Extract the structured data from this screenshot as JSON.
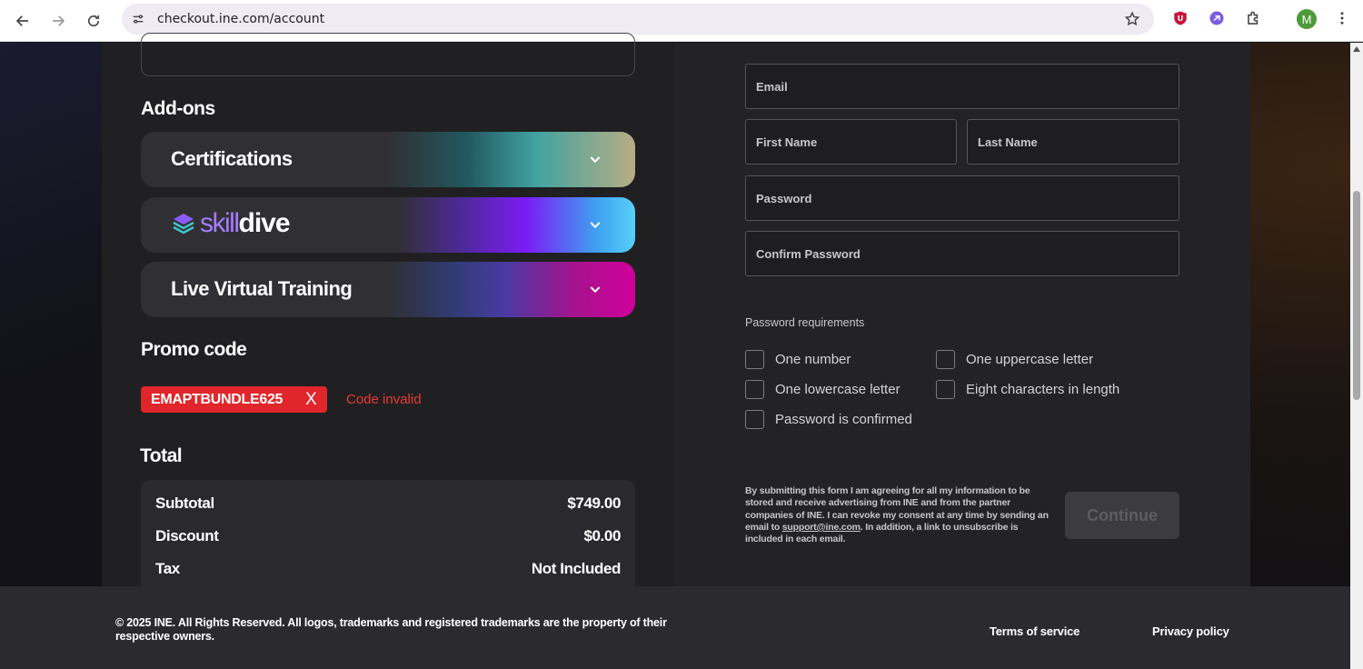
{
  "browser": {
    "url": "checkout.ine.com/account",
    "profile_initial": "M",
    "icons": [
      "back-icon",
      "forward-icon",
      "reload-icon",
      "site-info-icon",
      "bookmark-star-icon",
      "ublock-icon",
      "extension-icon",
      "puzzle-icon",
      "menu-dots-icon"
    ]
  },
  "addons": {
    "heading": "Add-ons",
    "items": [
      {
        "label": "Certifications"
      },
      {
        "label_a": "skill",
        "label_b": "dive"
      },
      {
        "label": "Live Virtual Training"
      }
    ]
  },
  "promo": {
    "heading": "Promo code",
    "code": "EMAPTBUNDLE625",
    "remove": "X",
    "status": "Code invalid",
    "status_color": "#e83a36"
  },
  "total": {
    "heading": "Total",
    "rows": [
      {
        "label": "Subtotal",
        "value": "$749.00"
      },
      {
        "label": "Discount",
        "value": "$0.00"
      },
      {
        "label": "Tax",
        "value": "Not Included"
      }
    ]
  },
  "form": {
    "email_placeholder": "Email",
    "first_name_placeholder": "First Name",
    "last_name_placeholder": "Last Name",
    "password_placeholder": "Password",
    "confirm_password_placeholder": "Confirm Password",
    "requirements_title": "Password requirements",
    "requirements": {
      "one_number": "One number",
      "one_uppercase": "One uppercase letter",
      "one_lowercase": "One lowercase letter",
      "eight_chars": "Eight characters in length",
      "confirmed": "Password is confirmed"
    },
    "consent_before": "By submitting this form I am agreeing for all my information to be stored and receive advertising from INE and from the partner companies of INE. I can revoke my consent at any time by sending an email to ",
    "consent_link": "support@ine.com",
    "consent_after": ". In addition, a link to unsubscribe is included in each email.",
    "continue_label": "Continue"
  },
  "footer": {
    "copyright": "© 2025 INE. All Rights Reserved. All logos, trademarks and registered trademarks are the property of their respective owners.",
    "terms": "Terms of service",
    "privacy": "Privacy policy"
  }
}
